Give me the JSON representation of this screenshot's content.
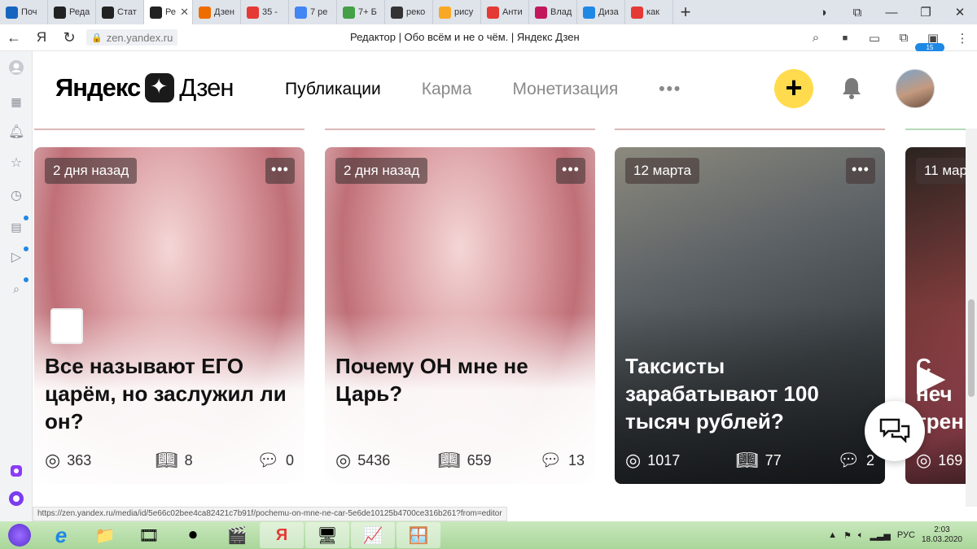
{
  "browser": {
    "tabs": [
      {
        "label": "Поч",
        "icon": "mail-icon",
        "color": "#1565c0"
      },
      {
        "label": "Реда",
        "icon": "zen-icon",
        "color": "#222222"
      },
      {
        "label": "Стат",
        "icon": "zen-icon",
        "color": "#222222"
      },
      {
        "label": "Ре",
        "icon": "zen-icon",
        "color": "#222222",
        "active": true
      },
      {
        "label": "Дзен",
        "icon": "chart-icon",
        "color": "#ef6c00"
      },
      {
        "label": "35 -",
        "icon": "mail-icon",
        "color": "#e53935"
      },
      {
        "label": "7 ре",
        "icon": "google-icon",
        "color": "#4285f4"
      },
      {
        "label": "7+ Б",
        "icon": "px-icon",
        "color": "#43a047"
      },
      {
        "label": "реко",
        "icon": "bag-icon",
        "color": "#333333"
      },
      {
        "label": "рису",
        "icon": "image-icon",
        "color": "#f9a825"
      },
      {
        "label": "Анти",
        "icon": "copyright-icon",
        "color": "#e53935"
      },
      {
        "label": "Влад",
        "icon": "instagram-icon",
        "color": "#c2185b"
      },
      {
        "label": "Диза",
        "icon": "canva-icon",
        "color": "#1e88e5"
      },
      {
        "label": "как",
        "icon": "yandex-icon",
        "color": "#e53935"
      }
    ],
    "close_glyph": "✕",
    "add_tab_glyph": "+",
    "window_controls": [
      "◑",
      "⧉",
      "—",
      "❐",
      "✕"
    ],
    "url": "zen.yandex.ru",
    "page_title": "Редактор | Обо всём и не о чём. | Яндекс Дзен",
    "nav_buttons": [
      "←",
      "Я",
      "↻"
    ],
    "addr_icons": [
      "⌕",
      "■",
      "▭",
      "⧉",
      "▣",
      "⋮"
    ],
    "downloads_badge": "15"
  },
  "sidebar_icons": [
    "avatar-icon",
    "apps-icon",
    "bell-icon",
    "star-icon",
    "history-icon",
    "news-icon",
    "video-icon",
    "search-doc-icon",
    "alice-icon"
  ],
  "zen": {
    "logo_bold": "Яндекс",
    "logo_regular": "Дзен",
    "nav": [
      "Публикации",
      "Карма",
      "Монетизация"
    ],
    "nav_more": "•••",
    "add_glyph": "+",
    "bell_glyph": "🔔"
  },
  "cards": [
    {
      "badge": "2 дня назад",
      "title": "Все называют ЕГО царём, но заслужил ли он?",
      "views": "363",
      "reads": "8",
      "comments": "0",
      "theme": "crown"
    },
    {
      "badge": "2 дня назад",
      "title": "Почему ОН мне не Царь?",
      "views": "5436",
      "reads": "659",
      "comments": "13",
      "theme": "crown"
    },
    {
      "badge": "12 марта",
      "title": "Таксисты зарабатывают 100 тысяч рублей?",
      "views": "1017",
      "reads": "77",
      "comments": "2",
      "theme": "car"
    },
    {
      "badge": "11 мар",
      "title": "С неч трен",
      "views": "169",
      "reads": "",
      "comments": "",
      "theme": "video"
    }
  ],
  "menu_glyph": "•••",
  "status_url": "https://zen.yandex.ru/media/id/5e66c02bee4ca82421c7b91f/pochemu-on-mne-ne-car-5e6de10125b4700ce316b261?from=editor",
  "taskbar": {
    "apps": [
      "🟣",
      "e",
      "📁",
      "🎞",
      "⏺",
      "🎬",
      "Я",
      "🖥",
      "📈",
      "🪟"
    ],
    "tray_lang": "РУС",
    "time": "2:03",
    "date": "18.03.2020"
  },
  "colors": {
    "accent_yellow": "#ffdb4d",
    "taskbar": "#b5dca6"
  }
}
